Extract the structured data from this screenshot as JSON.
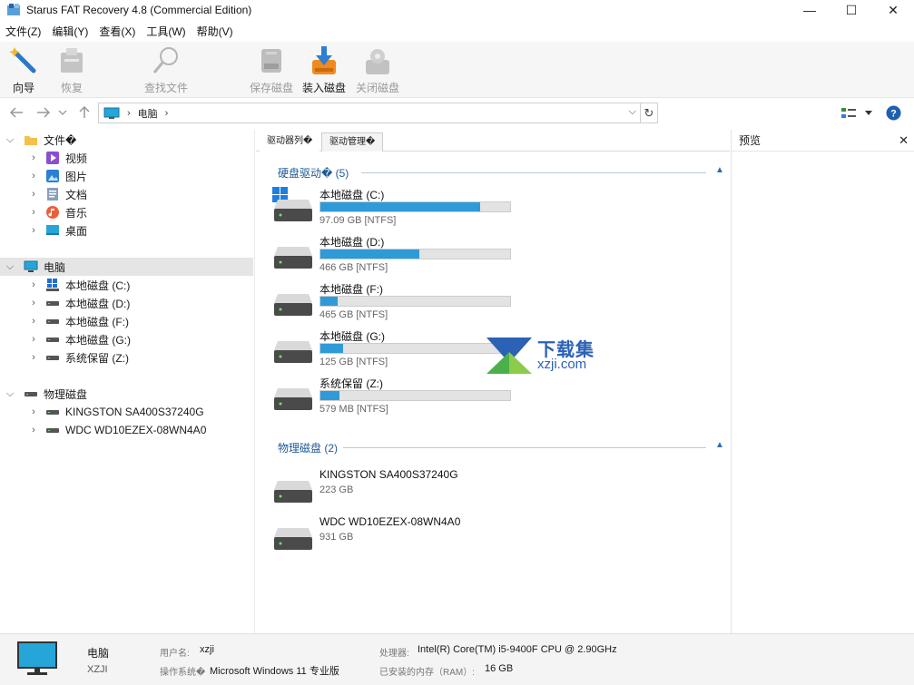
{
  "window": {
    "title": "Starus FAT Recovery 4.8 (Commercial Edition)",
    "minimize": "—",
    "maximize": "☐",
    "close": "✕"
  },
  "menu": [
    "文件(Z)",
    "编辑(Y)",
    "查看(X)",
    "工具(W)",
    "帮助(V)"
  ],
  "toolbar": {
    "wizard": "向导",
    "recover": "恢复",
    "find_file": "查找文件",
    "save_disk": "保存磁盘",
    "load_disk": "装入磁盘",
    "close_disk": "关闭磁盘"
  },
  "address": {
    "crumb": "电脑",
    "sep1": "›",
    "sep2": "›",
    "dropdown": "⌵",
    "refresh": "↻"
  },
  "tree": {
    "files": "文件�",
    "videos": "视频",
    "pictures": "图片",
    "documents": "文档",
    "music": "音乐",
    "desktop": "桌面",
    "computer": "电脑",
    "drives": [
      "本地磁盘 (C:)",
      "本地磁盘 (D:)",
      "本地磁盘 (F:)",
      "本地磁盘 (G:)",
      "系统保留 (Z:)"
    ],
    "physical": "物理磁盘",
    "phys_disks": [
      "KINGSTON SA400S37240G",
      "WDC WD10EZEX-08WN4A0"
    ]
  },
  "tabs": {
    "drive_list": "驱动器列�",
    "drive_manager": "驱动管理�"
  },
  "sections": {
    "hard_drives": "硬盘驱动� (5)",
    "physical_disks": "物理磁盘 (2)"
  },
  "drives": [
    {
      "name": "本地磁盘 (C:)",
      "size": "97.09 GB [NTFS]",
      "used": 0.84
    },
    {
      "name": "本地磁盘 (D:)",
      "size": "466 GB [NTFS]",
      "used": 0.52
    },
    {
      "name": "本地磁盘 (F:)",
      "size": "465 GB [NTFS]",
      "used": 0.09
    },
    {
      "name": "本地磁盘 (G:)",
      "size": "125 GB [NTFS]",
      "used": 0.12
    },
    {
      "name": "系统保留 (Z:)",
      "size": "579 MB [NTFS]",
      "used": 0.1
    }
  ],
  "physical_disks": [
    {
      "name": "KINGSTON SA400S37240G",
      "size": "223 GB"
    },
    {
      "name": "WDC WD10EZEX-08WN4A0",
      "size": "931 GB"
    }
  ],
  "preview": {
    "title": "预览",
    "close": "✕"
  },
  "status": {
    "pc_name": "电脑",
    "pc_host": "XZJI",
    "user_label": "用户名:",
    "user_value": "xzji",
    "os_label": "操作系统�",
    "os_value": "Microsoft Windows 11 专业版",
    "cpu_label": "处理器:",
    "cpu_value": "Intel(R) Core(TM) i5-9400F CPU @ 2.90GHz",
    "ram_label": "已安装的内存（RAM）:",
    "ram_value": "16 GB"
  },
  "watermark": {
    "line1": "下载集",
    "line2": "xzji.com"
  },
  "colors": {
    "accent": "#2f9ad8",
    "section": "#1e5a96"
  }
}
